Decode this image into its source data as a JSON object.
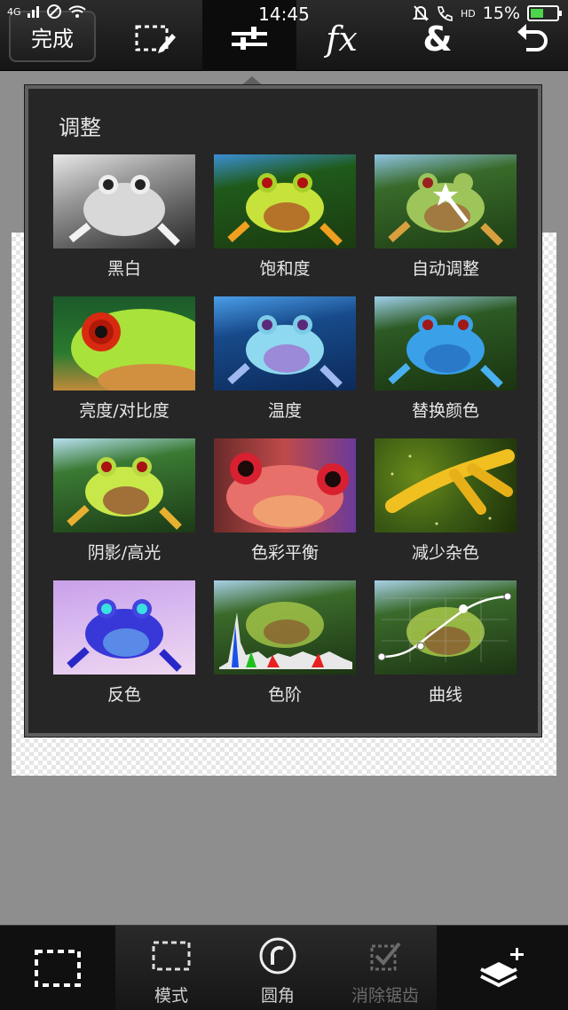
{
  "status": {
    "network": "4G",
    "time": "14:45",
    "hd": "HD",
    "battery": "15%"
  },
  "toolbar": {
    "done_label": "完成",
    "fx_label": "fx",
    "amp_label": "&"
  },
  "panel": {
    "title": "调整",
    "items": [
      {
        "label": "黑白"
      },
      {
        "label": "饱和度"
      },
      {
        "label": "自动调整"
      },
      {
        "label": "亮度/对比度"
      },
      {
        "label": "温度"
      },
      {
        "label": "替换颜色"
      },
      {
        "label": "阴影/高光"
      },
      {
        "label": "色彩平衡"
      },
      {
        "label": "减少杂色"
      },
      {
        "label": "反色"
      },
      {
        "label": "色阶"
      },
      {
        "label": "曲线"
      }
    ]
  },
  "bottombar": {
    "mode_label": "模式",
    "round_label": "圆角",
    "antialias_label": "消除锯齿"
  }
}
